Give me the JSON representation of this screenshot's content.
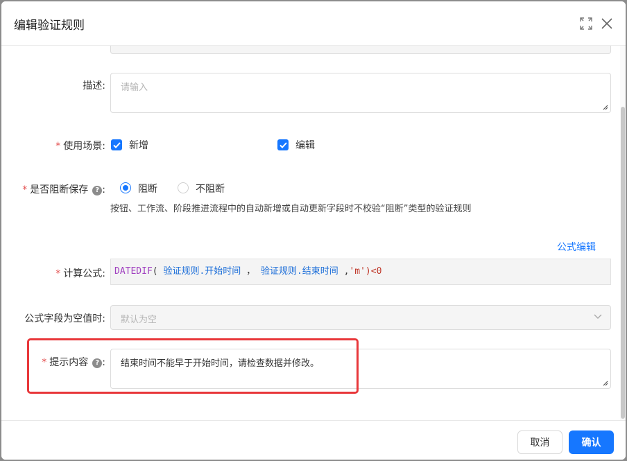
{
  "dialog": {
    "title": "编辑验证规则",
    "icons": {
      "fullscreen": "fullscreen-icon",
      "close": "close-icon"
    }
  },
  "form": {
    "description": {
      "label": "描述:",
      "placeholder": "请输入",
      "value": ""
    },
    "scenario": {
      "label": "使用场景:",
      "required": "*",
      "options": [
        {
          "label": "新增",
          "checked": true
        },
        {
          "label": "编辑",
          "checked": true
        }
      ]
    },
    "block_save": {
      "label": "是否阻断保存",
      "required": "*",
      "help": "?",
      "colon": ":",
      "options": [
        {
          "label": "阻断",
          "selected": true
        },
        {
          "label": "不阻断",
          "selected": false
        }
      ],
      "hint": "按钮、工作流、阶段推进流程中的自动新增或自动更新字段时不校验“阻断”类型的验证规则"
    },
    "formula": {
      "edit_link": "公式编辑",
      "label": "计算公式:",
      "required": "*",
      "tokens": {
        "fn": "DATEDIF",
        "open": "(",
        "ref1": "验证规则.开始时间",
        "sep1": "，",
        "ref2": "验证规则.结束时间",
        "sep2": ",",
        "arg": "'m'",
        "close": ")<0"
      }
    },
    "null_value": {
      "label": "公式字段为空值时:",
      "placeholder": "默认为空"
    },
    "message": {
      "label": "提示内容",
      "required": "*",
      "help": "?",
      "colon": ":",
      "value": "结束时间不能早于开始时间，请检查数据并修改。"
    }
  },
  "footer": {
    "cancel": "取消",
    "confirm": "确认"
  },
  "colors": {
    "accent": "#1677ff",
    "required": "#e34d4d",
    "highlight": "#e8373a"
  }
}
